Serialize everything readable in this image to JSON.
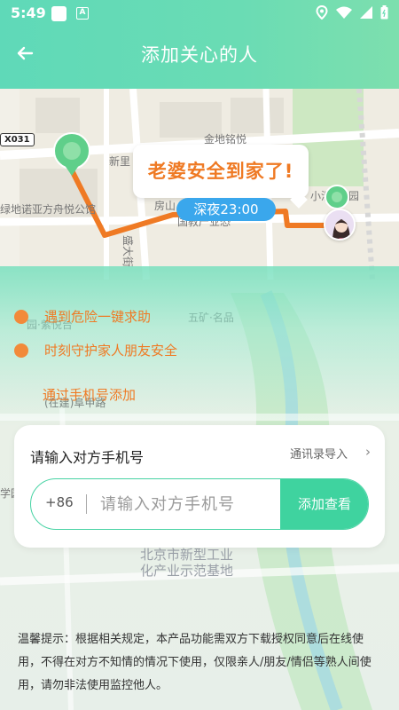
{
  "status_bar": {
    "time": "5:49",
    "app_icon_label": "A"
  },
  "nav": {
    "title": "添加关心的人"
  },
  "map": {
    "road_tag": "X031",
    "bubble_text": "老婆安全到家了!",
    "night_pill": "深夜23:00",
    "labels": [
      "新里",
      "金地铭悦",
      "房山",
      "国教产业恐",
      "小清",
      "园",
      "绿地诺亚方舟悦公馆",
      "盛大街",
      "园·紫悦台",
      "五矿·名品",
      "北京市新型工业",
      "化产业示范基地",
      "(在建)阜甲路",
      "学园"
    ]
  },
  "features": [
    {
      "text": "遇到危险一键求助"
    },
    {
      "text": "时刻守护家人朋友安全"
    }
  ],
  "add_by_phone_link": "通过手机号添加",
  "card": {
    "title": "请输入对方手机号",
    "import_label": "通讯录导入",
    "country_code": "+86",
    "input_placeholder": "请输入对方手机号",
    "submit_label": "添加查看"
  },
  "notice": "温馨提示：根据相关规定，本产品功能需双方下载授权同意后在线使用，不得在对方不知情的情况下使用，仅限亲人/朋友/情侣等熟人间使用，请勿非法使用监控他人。",
  "colors": {
    "accent_green": "#3fd39f",
    "accent_orange": "#ef7a24",
    "pill_blue": "#3aa7ec"
  }
}
